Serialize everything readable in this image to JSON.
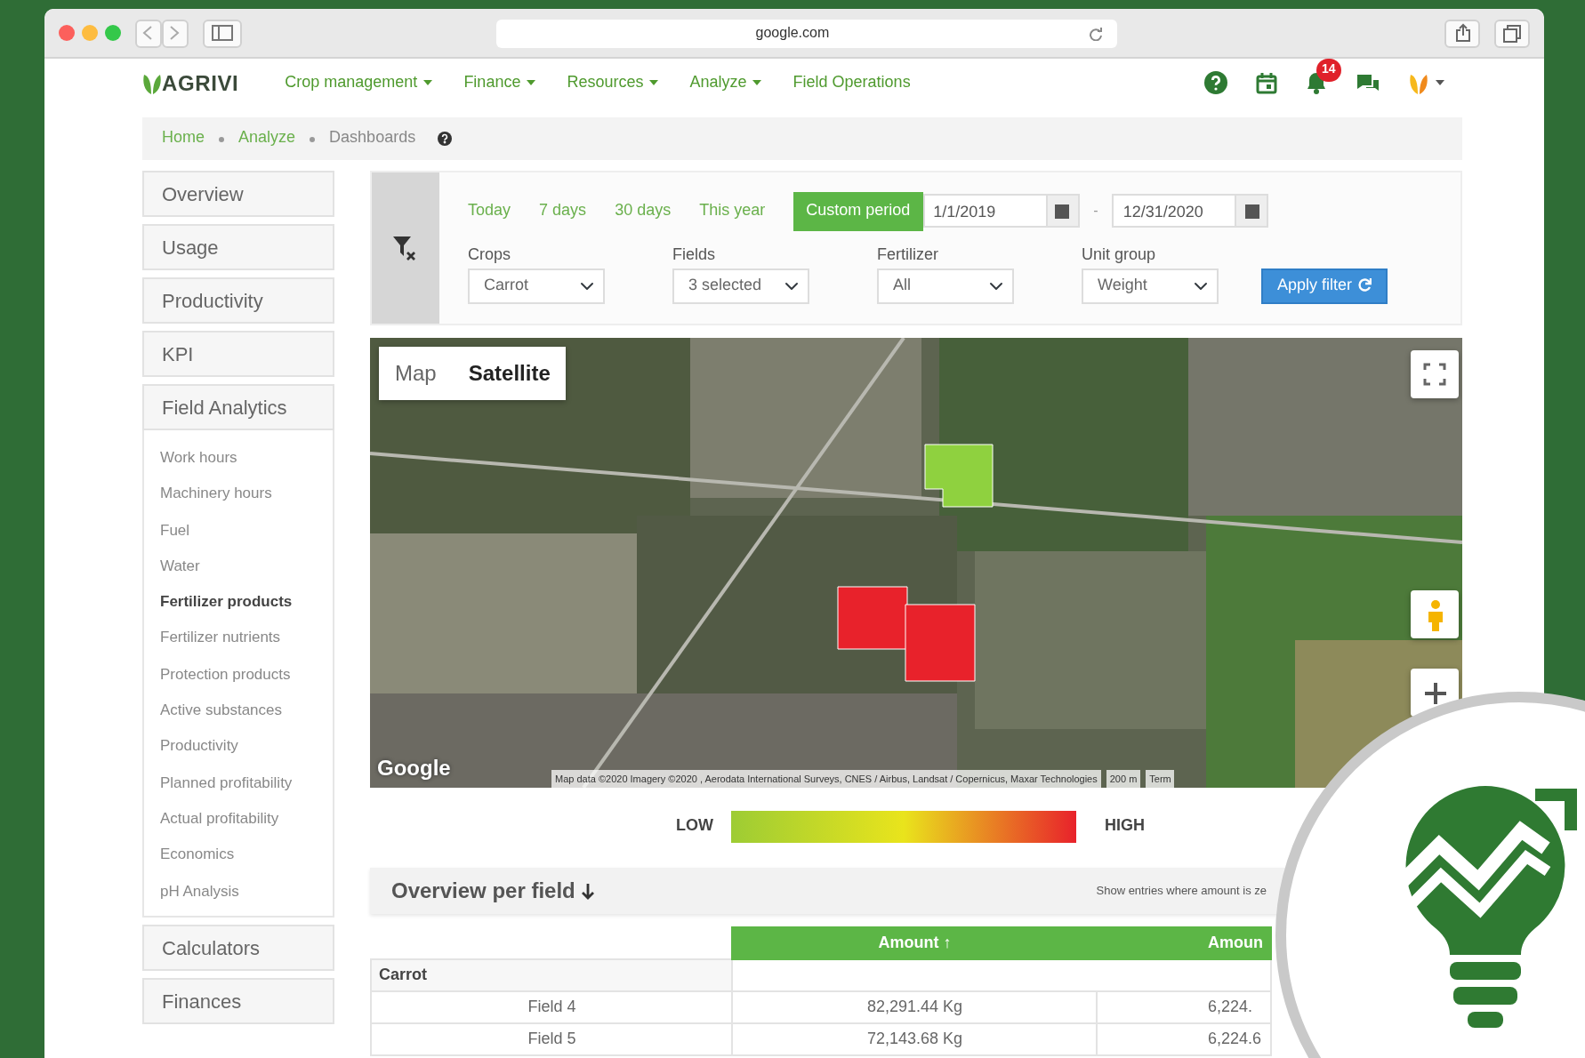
{
  "browser": {
    "address": "google.com"
  },
  "navbar": {
    "logo": "AGRIVI",
    "menu": [
      {
        "label": "Crop management",
        "dropdown": true
      },
      {
        "label": "Finance",
        "dropdown": true
      },
      {
        "label": "Resources",
        "dropdown": true
      },
      {
        "label": "Analyze",
        "dropdown": true
      },
      {
        "label": "Field Operations",
        "dropdown": false
      }
    ],
    "notifications": "14"
  },
  "breadcrumb": [
    {
      "label": "Home",
      "link": true
    },
    {
      "label": "Analyze",
      "link": true
    },
    {
      "label": "Dashboards",
      "link": false
    }
  ],
  "sidebar": [
    {
      "label": "Overview",
      "kind": "section"
    },
    {
      "label": "Usage",
      "kind": "section"
    },
    {
      "label": "Productivity",
      "kind": "section"
    },
    {
      "label": "KPI",
      "kind": "section"
    },
    {
      "label": "Field Analytics",
      "kind": "section",
      "children": [
        {
          "label": "Work hours",
          "selected": false
        },
        {
          "label": "Machinery hours",
          "selected": false
        },
        {
          "label": "Fuel",
          "selected": false
        },
        {
          "label": "Water",
          "selected": false
        },
        {
          "label": "Fertilizer products",
          "selected": true
        },
        {
          "label": "Fertilizer nutrients",
          "selected": false
        },
        {
          "label": "Protection products",
          "selected": false
        },
        {
          "label": "Active substances",
          "selected": false
        },
        {
          "label": "Productivity",
          "selected": false
        },
        {
          "label": "Planned profitability",
          "selected": false
        },
        {
          "label": "Actual profitability",
          "selected": false
        },
        {
          "label": "Economics",
          "selected": false
        },
        {
          "label": "pH Analysis",
          "selected": false
        }
      ]
    },
    {
      "label": "Calculators",
      "kind": "section"
    },
    {
      "label": "Finances",
      "kind": "section"
    }
  ],
  "filters": {
    "periods": [
      {
        "label": "Today",
        "selected": false
      },
      {
        "label": "7 days",
        "selected": false
      },
      {
        "label": "30 days",
        "selected": false
      },
      {
        "label": "This year",
        "selected": false
      },
      {
        "label": "Custom period",
        "selected": true
      }
    ],
    "date_from": "1/1/2019",
    "separator": "-",
    "date_to": "12/31/2020",
    "selects": [
      {
        "label": "Crops",
        "value": "Carrot"
      },
      {
        "label": "Fields",
        "value": "3 selected"
      },
      {
        "label": "Fertilizer",
        "value": "All"
      },
      {
        "label": "Unit group",
        "value": "Weight"
      }
    ],
    "apply": "Apply filter"
  },
  "map": {
    "types": [
      {
        "label": "Map",
        "selected": false
      },
      {
        "label": "Satellite",
        "selected": true
      }
    ],
    "logo": "Google",
    "attribution": "Map data ©2020 Imagery ©2020 , Aerodata International Surveys, CNES / Airbus, Landsat / Copernicus, Maxar Technologies",
    "scale": "200 m",
    "terms": "Term",
    "fields": [
      {
        "color": "#8fd13f"
      },
      {
        "color": "#e8222b"
      },
      {
        "color": "#e8222b"
      }
    ]
  },
  "legend": {
    "low": "LOW",
    "high": "HIGH"
  },
  "overview": {
    "title": "Overview per field",
    "toggle_text": "Show entries where amount is ze",
    "columns": [
      "Amount ↑",
      "Amoun"
    ],
    "groups": [
      {
        "name": "Carrot",
        "rows": [
          {
            "field": "Field 4",
            "values": [
              "82,291.44 Kg",
              "6,224."
            ]
          },
          {
            "field": "Field 5",
            "values": [
              "72,143.68 Kg",
              "6,224.6"
            ]
          }
        ]
      }
    ]
  }
}
